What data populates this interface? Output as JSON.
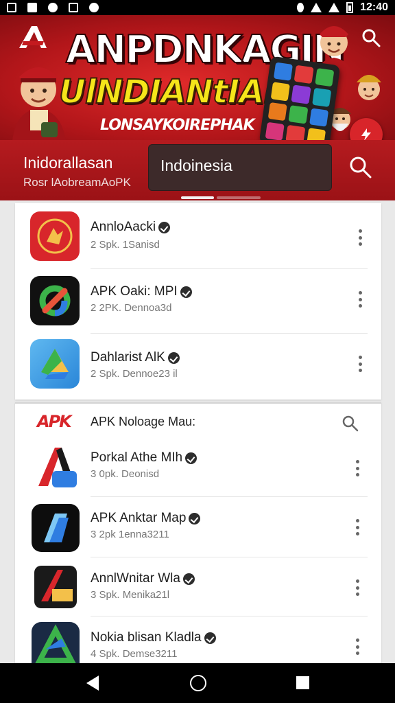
{
  "status_bar": {
    "time": "12:40"
  },
  "banner": {
    "title": "ANPDNKAGIN",
    "subtitle": "UlNDIANtIAN",
    "tagline": "LONSAYKOIREPHAK"
  },
  "header": {
    "title": "Inidorallasan",
    "subtitle": "Rosr lAobreamAoPK",
    "search_value": "Indoinesia"
  },
  "list1": {
    "items": [
      {
        "name": "AnnloAacki",
        "meta": "2 Spk. 1Sanisd",
        "icon": "red-emblem-icon"
      },
      {
        "name": "APK Oaki: MPI",
        "meta": "2 2PK. Dennoa3d",
        "icon": "dark-colorful-loop-icon"
      },
      {
        "name": "Dahlarist AlK",
        "meta": "2 Spk. Dennoe23 il",
        "icon": "blue-drive-icon"
      }
    ]
  },
  "section2": {
    "logo": "APK",
    "title": "APK Noloage Mau:",
    "items": [
      {
        "name": "Porkal Athe MIh",
        "meta": "3 0pk. Deonisd",
        "icon": "red-blue-arrow-icon"
      },
      {
        "name": "APK Anktar Map",
        "meta": "3 2pk 1enna3211",
        "icon": "blue-book-icon"
      },
      {
        "name": "AnnlWnitar Wla",
        "meta": "3 Spk. Menika21l",
        "icon": "yellow-arrow-icon"
      },
      {
        "name": "Nokia blisan Kladla",
        "meta": "4 Spk. Demse3211",
        "icon": "green-triangle-icon"
      }
    ]
  },
  "colors": {
    "accent": "#b51b1f",
    "header_dark": "#9b1216",
    "search_field": "#3d2a2a",
    "subtitle_yellow": "#f5e51a"
  }
}
